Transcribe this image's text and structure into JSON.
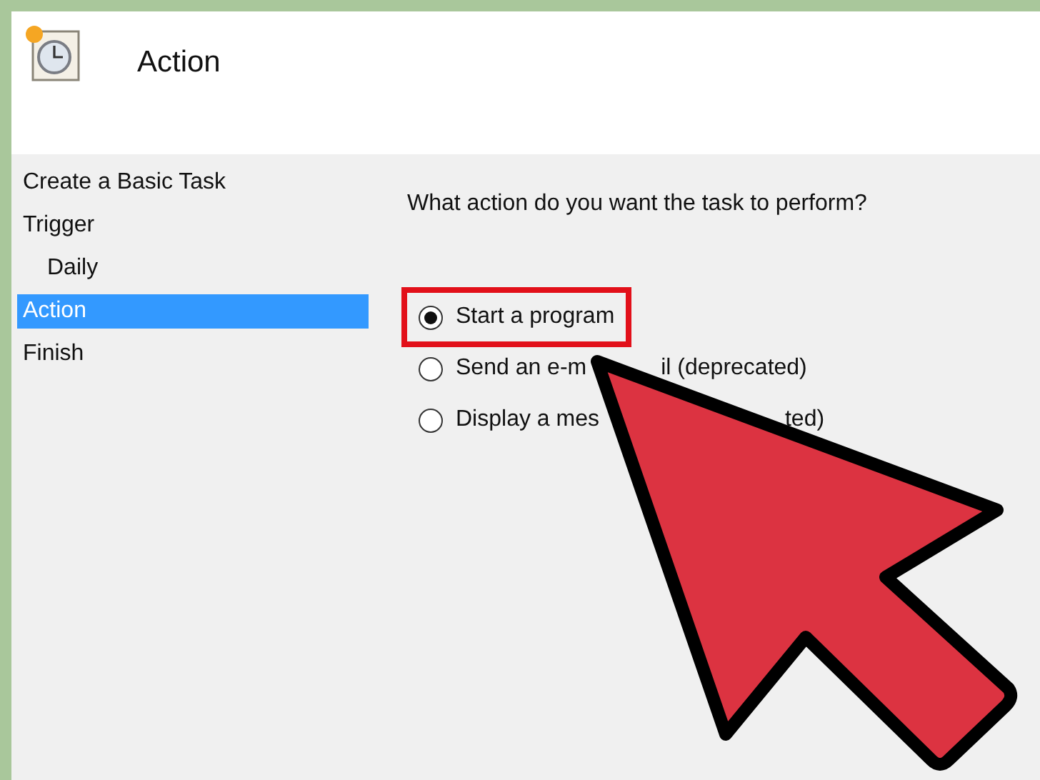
{
  "header": {
    "title": "Action"
  },
  "sidebar": {
    "items": [
      {
        "label": "Create a Basic Task",
        "selected": false
      },
      {
        "label": "Trigger",
        "selected": false,
        "children": [
          {
            "label": "Daily",
            "selected": false
          }
        ]
      },
      {
        "label": "Action",
        "selected": true
      },
      {
        "label": "Finish",
        "selected": false
      }
    ]
  },
  "content": {
    "question": "What action do you want the task to perform?",
    "options": [
      {
        "label_parts": [
          "Start a program"
        ],
        "selected": true,
        "highlighted": true
      },
      {
        "label_parts": [
          "Send an e-m",
          "il (deprecated)"
        ],
        "selected": false,
        "highlighted": false
      },
      {
        "label_parts": [
          "Display a mes",
          "ted)"
        ],
        "selected": false,
        "highlighted": false
      }
    ]
  }
}
